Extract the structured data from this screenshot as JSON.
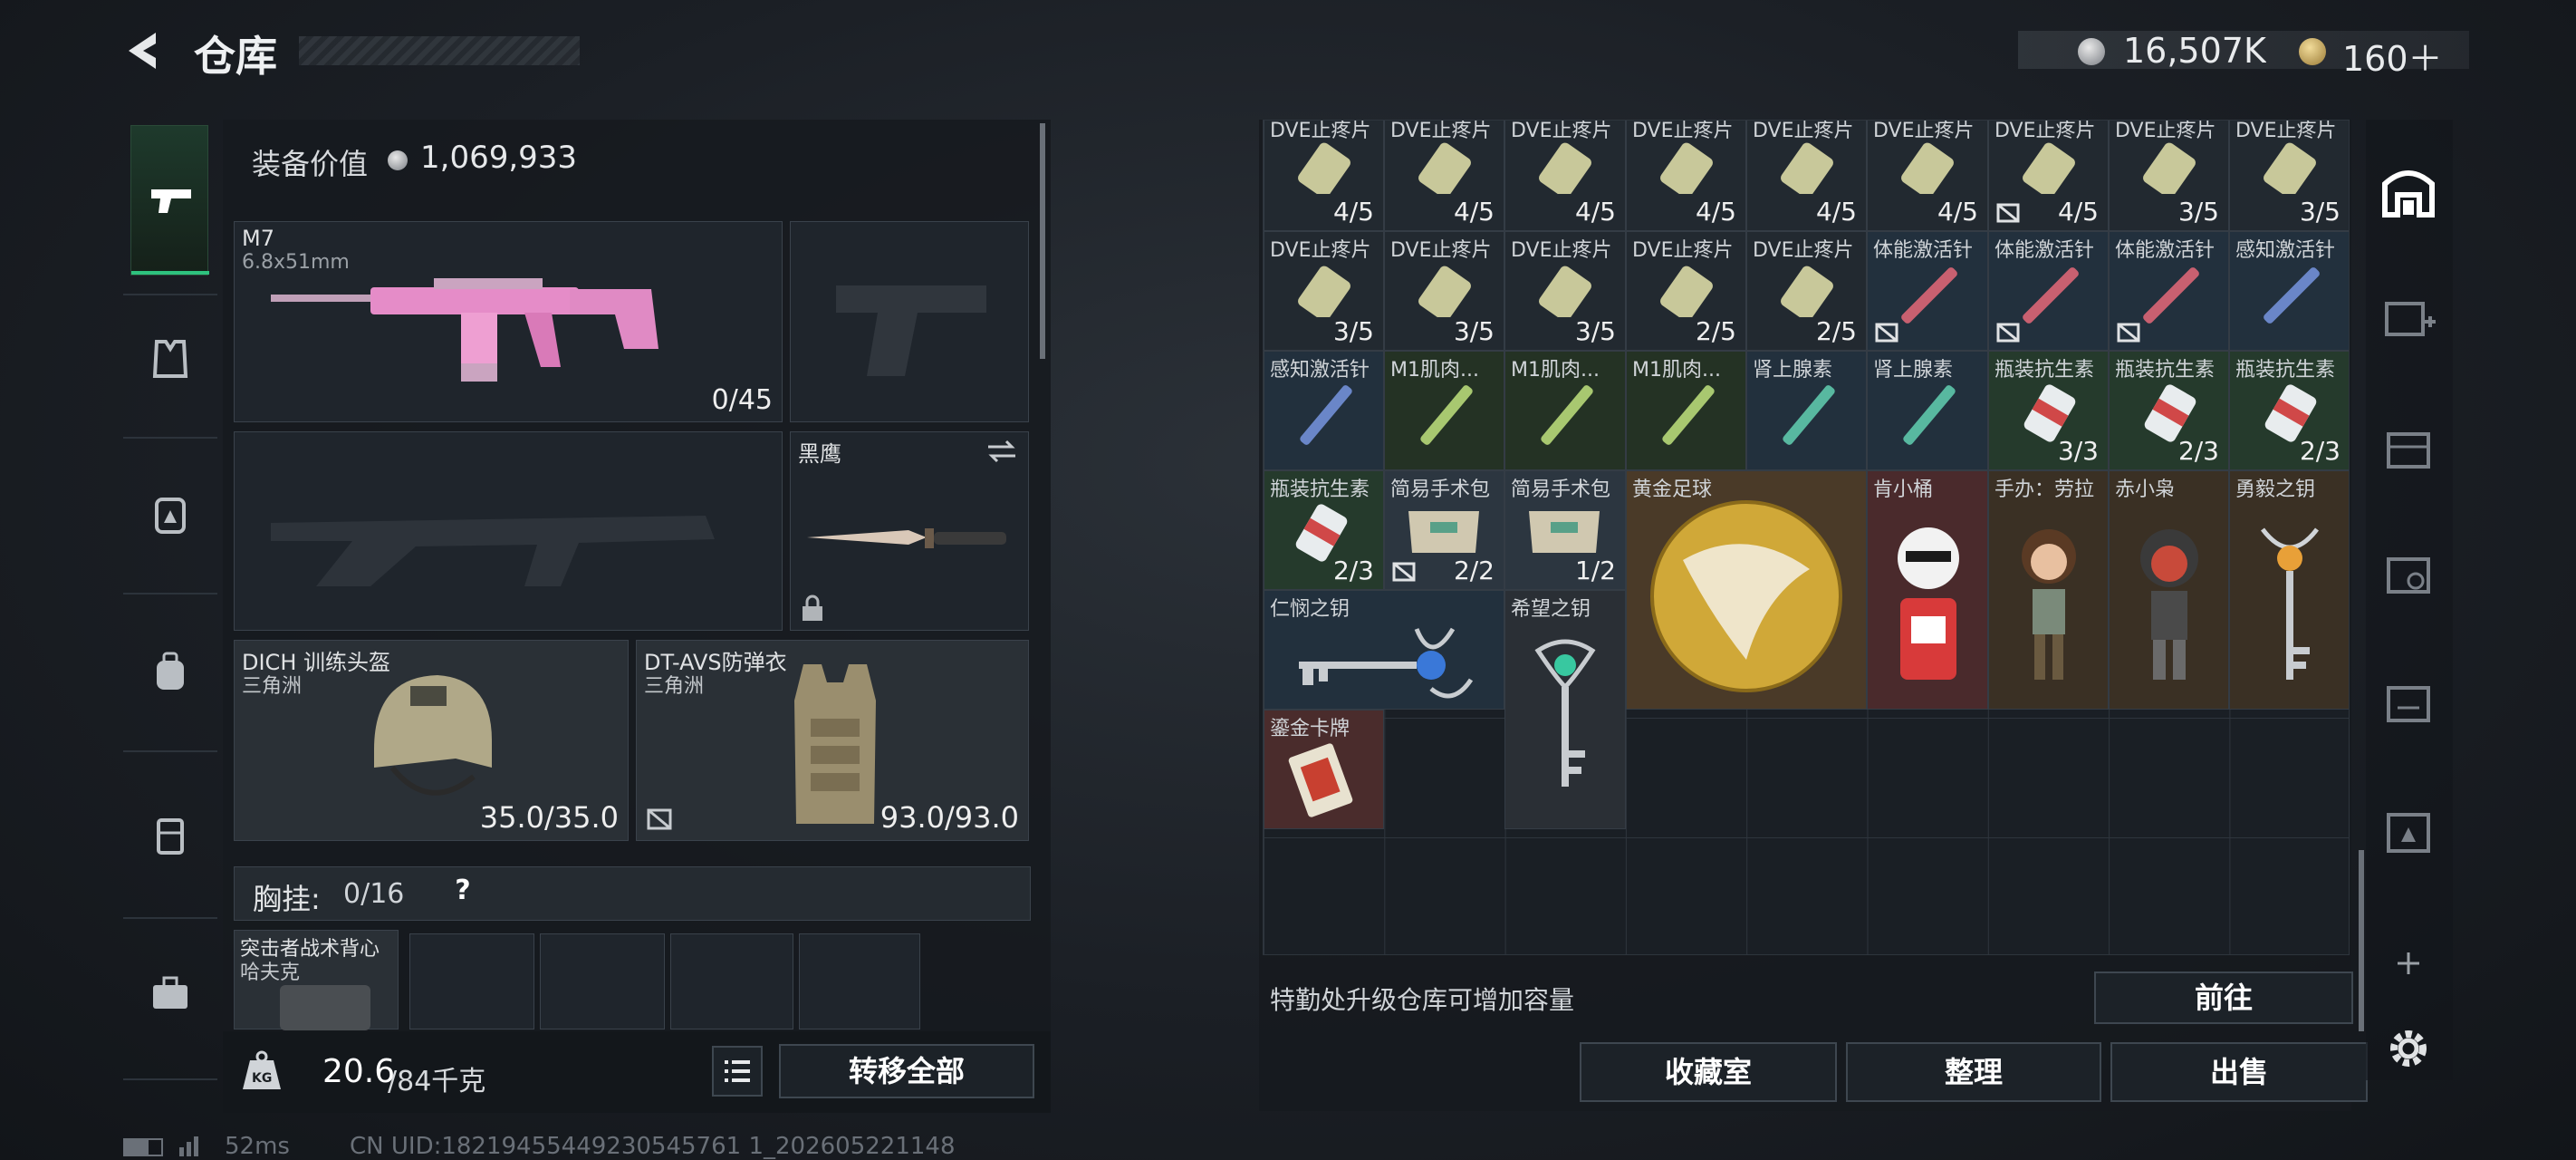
{
  "header": {
    "title": "仓库",
    "currency1": "16,507K",
    "currency2": "160＋"
  },
  "loadout": {
    "equip_label": "装备价值",
    "equip_value": "1,069,933",
    "primary": {
      "name": "M7",
      "caliber": "6.8x51mm",
      "ammo": "0/45"
    },
    "melee": {
      "name": "黑鹰"
    },
    "helmet": {
      "name": "DICH 训练头盔",
      "origin": "三角洲",
      "durability": "35.0/35.0"
    },
    "armor": {
      "name": "DT-AVS防弹衣",
      "origin": "三角洲",
      "durability": "93.0/93.0"
    },
    "chest": {
      "label": "胸挂:",
      "value": "0/16",
      "help": "?"
    },
    "backpack": {
      "name": "突击者战术背心",
      "origin": "哈夫克"
    },
    "weight": {
      "current": "20.6",
      "max": "/84千克"
    },
    "transfer_label": "转移全部"
  },
  "grid": {
    "row0": [
      {
        "name": "DVE止疼片",
        "count": "4/5"
      },
      {
        "name": "DVE止疼片",
        "count": "4/5"
      },
      {
        "name": "DVE止疼片",
        "count": "4/5"
      },
      {
        "name": "DVE止疼片",
        "count": "4/5"
      },
      {
        "name": "DVE止疼片",
        "count": "4/5"
      },
      {
        "name": "DVE止疼片",
        "count": "4/5"
      },
      {
        "name": "DVE止疼片",
        "count": "4/5"
      },
      {
        "name": "DVE止疼片",
        "count": "3/5"
      },
      {
        "name": "DVE止疼片",
        "count": "3/5"
      }
    ],
    "row1": [
      {
        "name": "DVE止疼片",
        "count": "3/5"
      },
      {
        "name": "DVE止疼片",
        "count": "3/5"
      },
      {
        "name": "DVE止疼片",
        "count": "3/5"
      },
      {
        "name": "DVE止疼片",
        "count": "2/5"
      },
      {
        "name": "DVE止疼片",
        "count": "2/5"
      },
      {
        "name": "体能激活针",
        "count": ""
      },
      {
        "name": "体能激活针",
        "count": ""
      },
      {
        "name": "体能激活针",
        "count": ""
      },
      {
        "name": "感知激活针",
        "count": ""
      }
    ],
    "row2": [
      {
        "name": "感知激活针",
        "count": ""
      },
      {
        "name": "M1肌肉...",
        "count": ""
      },
      {
        "name": "M1肌肉...",
        "count": ""
      },
      {
        "name": "M1肌肉...",
        "count": ""
      },
      {
        "name": "肾上腺素",
        "count": ""
      },
      {
        "name": "肾上腺素",
        "count": ""
      },
      {
        "name": "瓶装抗生素",
        "count": "3/3"
      },
      {
        "name": "瓶装抗生素",
        "count": "2/3"
      },
      {
        "name": "瓶装抗生素",
        "count": "2/3"
      }
    ],
    "row3": [
      {
        "name": "瓶装抗生素",
        "count": "2/3"
      },
      {
        "name": "简易手术包",
        "count": "2/2"
      },
      {
        "name": "简易手术包",
        "count": "1/2"
      },
      {
        "name": "黄金足球",
        "count": ""
      },
      {
        "name": "肯小桶",
        "count": ""
      },
      {
        "name": "手办：劳拉",
        "count": ""
      },
      {
        "name": "赤小枭",
        "count": ""
      },
      {
        "name": "勇毅之钥",
        "count": ""
      }
    ],
    "row4": [
      {
        "name": "仁悯之钥",
        "count": ""
      },
      {
        "name": "希望之钥",
        "count": ""
      }
    ],
    "row5": [
      {
        "name": "鎏金卡牌",
        "count": ""
      }
    ],
    "upgrade_tip": "特勤处升级仓库可增加容量",
    "goto_label": "前往"
  },
  "actions": {
    "collection": "收藏室",
    "organize": "整理",
    "sell": "出售"
  },
  "status": {
    "ping": "52ms",
    "uid": "CN UID:18219455449230545761 1_202605221148"
  },
  "colors": {
    "accent": "#2ec27e",
    "panel": "#1f252c",
    "rare_red": "#6b2a2a",
    "rare_gold": "#5a4530",
    "rare_green": "#2a4a35",
    "rare_blue": "#2a3e52"
  }
}
